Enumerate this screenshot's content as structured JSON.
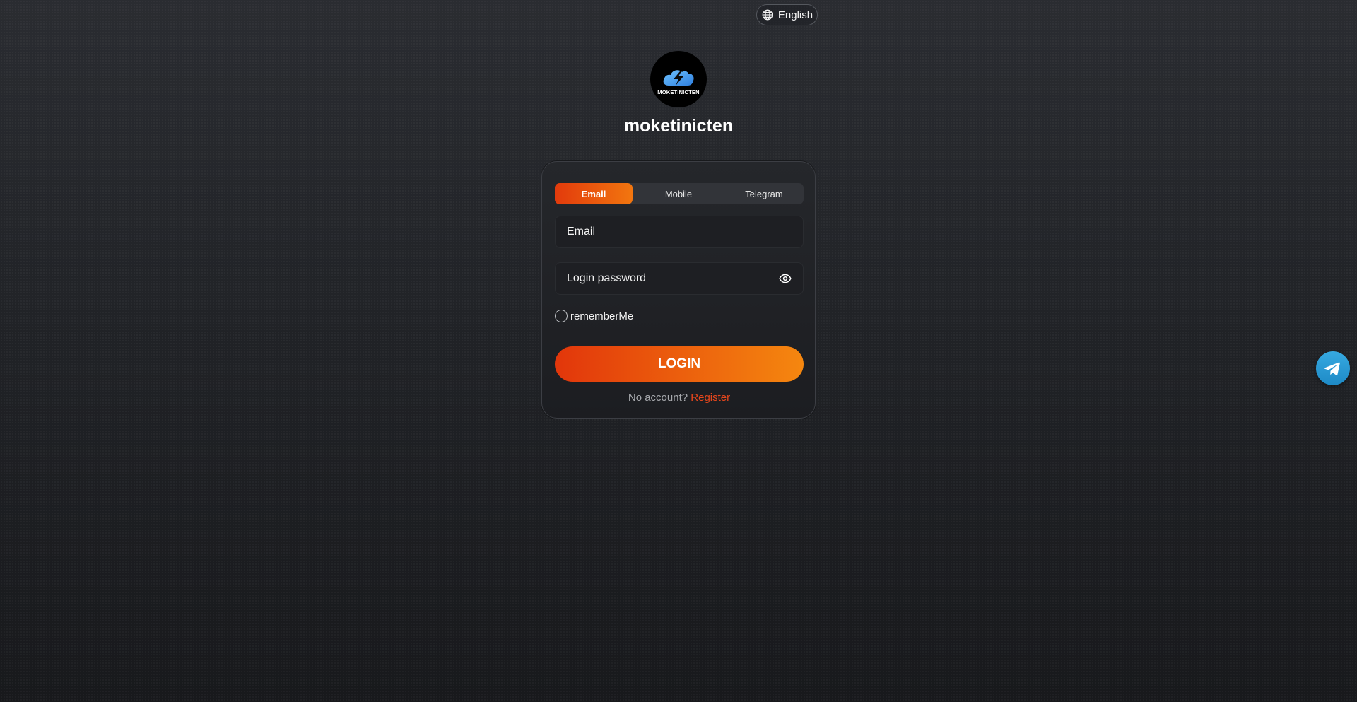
{
  "header": {
    "language": "English",
    "language_icon": "globe-icon"
  },
  "brand": {
    "logo_text": "MOKETINICTEN",
    "site_name": "moketinicten"
  },
  "login": {
    "tabs": [
      {
        "label": "Email",
        "active": true
      },
      {
        "label": "Mobile",
        "active": false
      },
      {
        "label": "Telegram",
        "active": false
      }
    ],
    "email_placeholder": "Email",
    "email_value": "",
    "password_placeholder": "Login password",
    "password_value": "",
    "password_toggle_icon": "eye-icon",
    "remember_label": "rememberMe",
    "remember_checked": false,
    "submit_label": "LOGIN",
    "no_account_text": "No account?",
    "register_label": "Register"
  },
  "floating": {
    "telegram_icon": "telegram-icon"
  },
  "colors": {
    "accent_start": "#e2360b",
    "accent_end": "#f5870f",
    "register_link": "#e8471c",
    "telegram_blue": "#2a9bd6"
  }
}
